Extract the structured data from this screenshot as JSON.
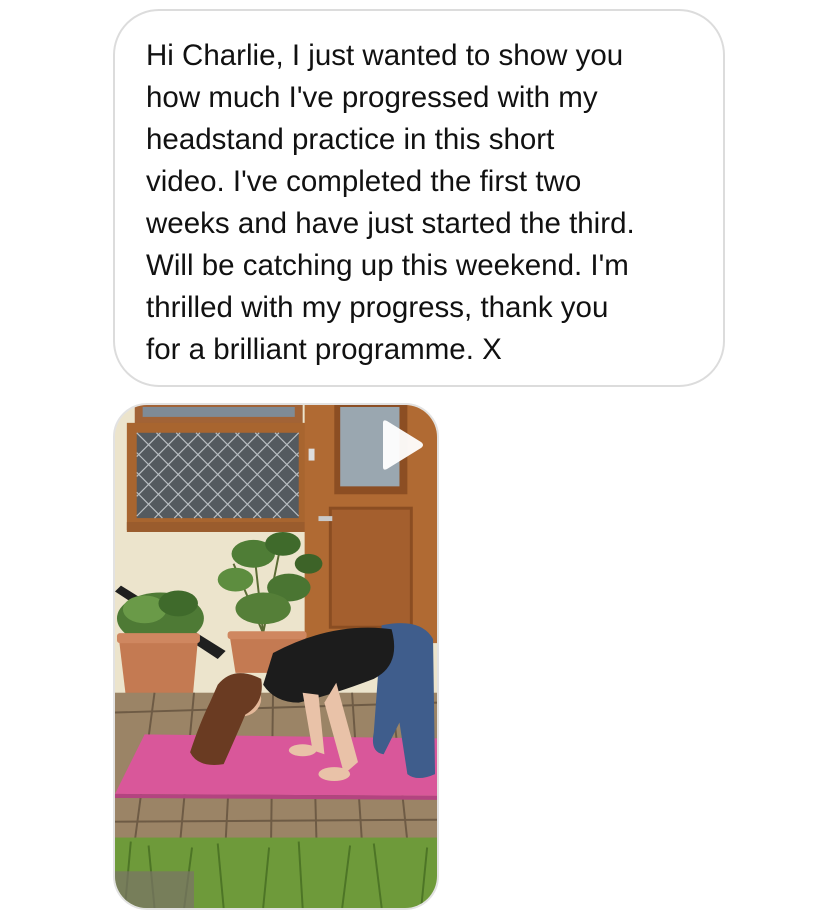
{
  "message": {
    "text": "Hi Charlie, I just wanted to show you\nhow much I've progressed with my\nheadstand practice in this short\nvideo. I've completed the first two\nweeks and have just started the third.\nWill be catching up this weekend. I'm\nthrilled with my progress, thank you\nfor a brilliant programme. X"
  },
  "video": {
    "icon": "play-icon",
    "scene": "woman on pink yoga mat on decking in front of house",
    "colors": {
      "wall": "#ece4cc",
      "door": "#b06a33",
      "mat": "#d9579a",
      "decking": "#9b8466",
      "grass": "#6e9a3a",
      "shirt": "#1c1c1c",
      "jeans": "#3f5d8c",
      "hair": "#6a3b22",
      "pot": "#c47a52"
    }
  }
}
